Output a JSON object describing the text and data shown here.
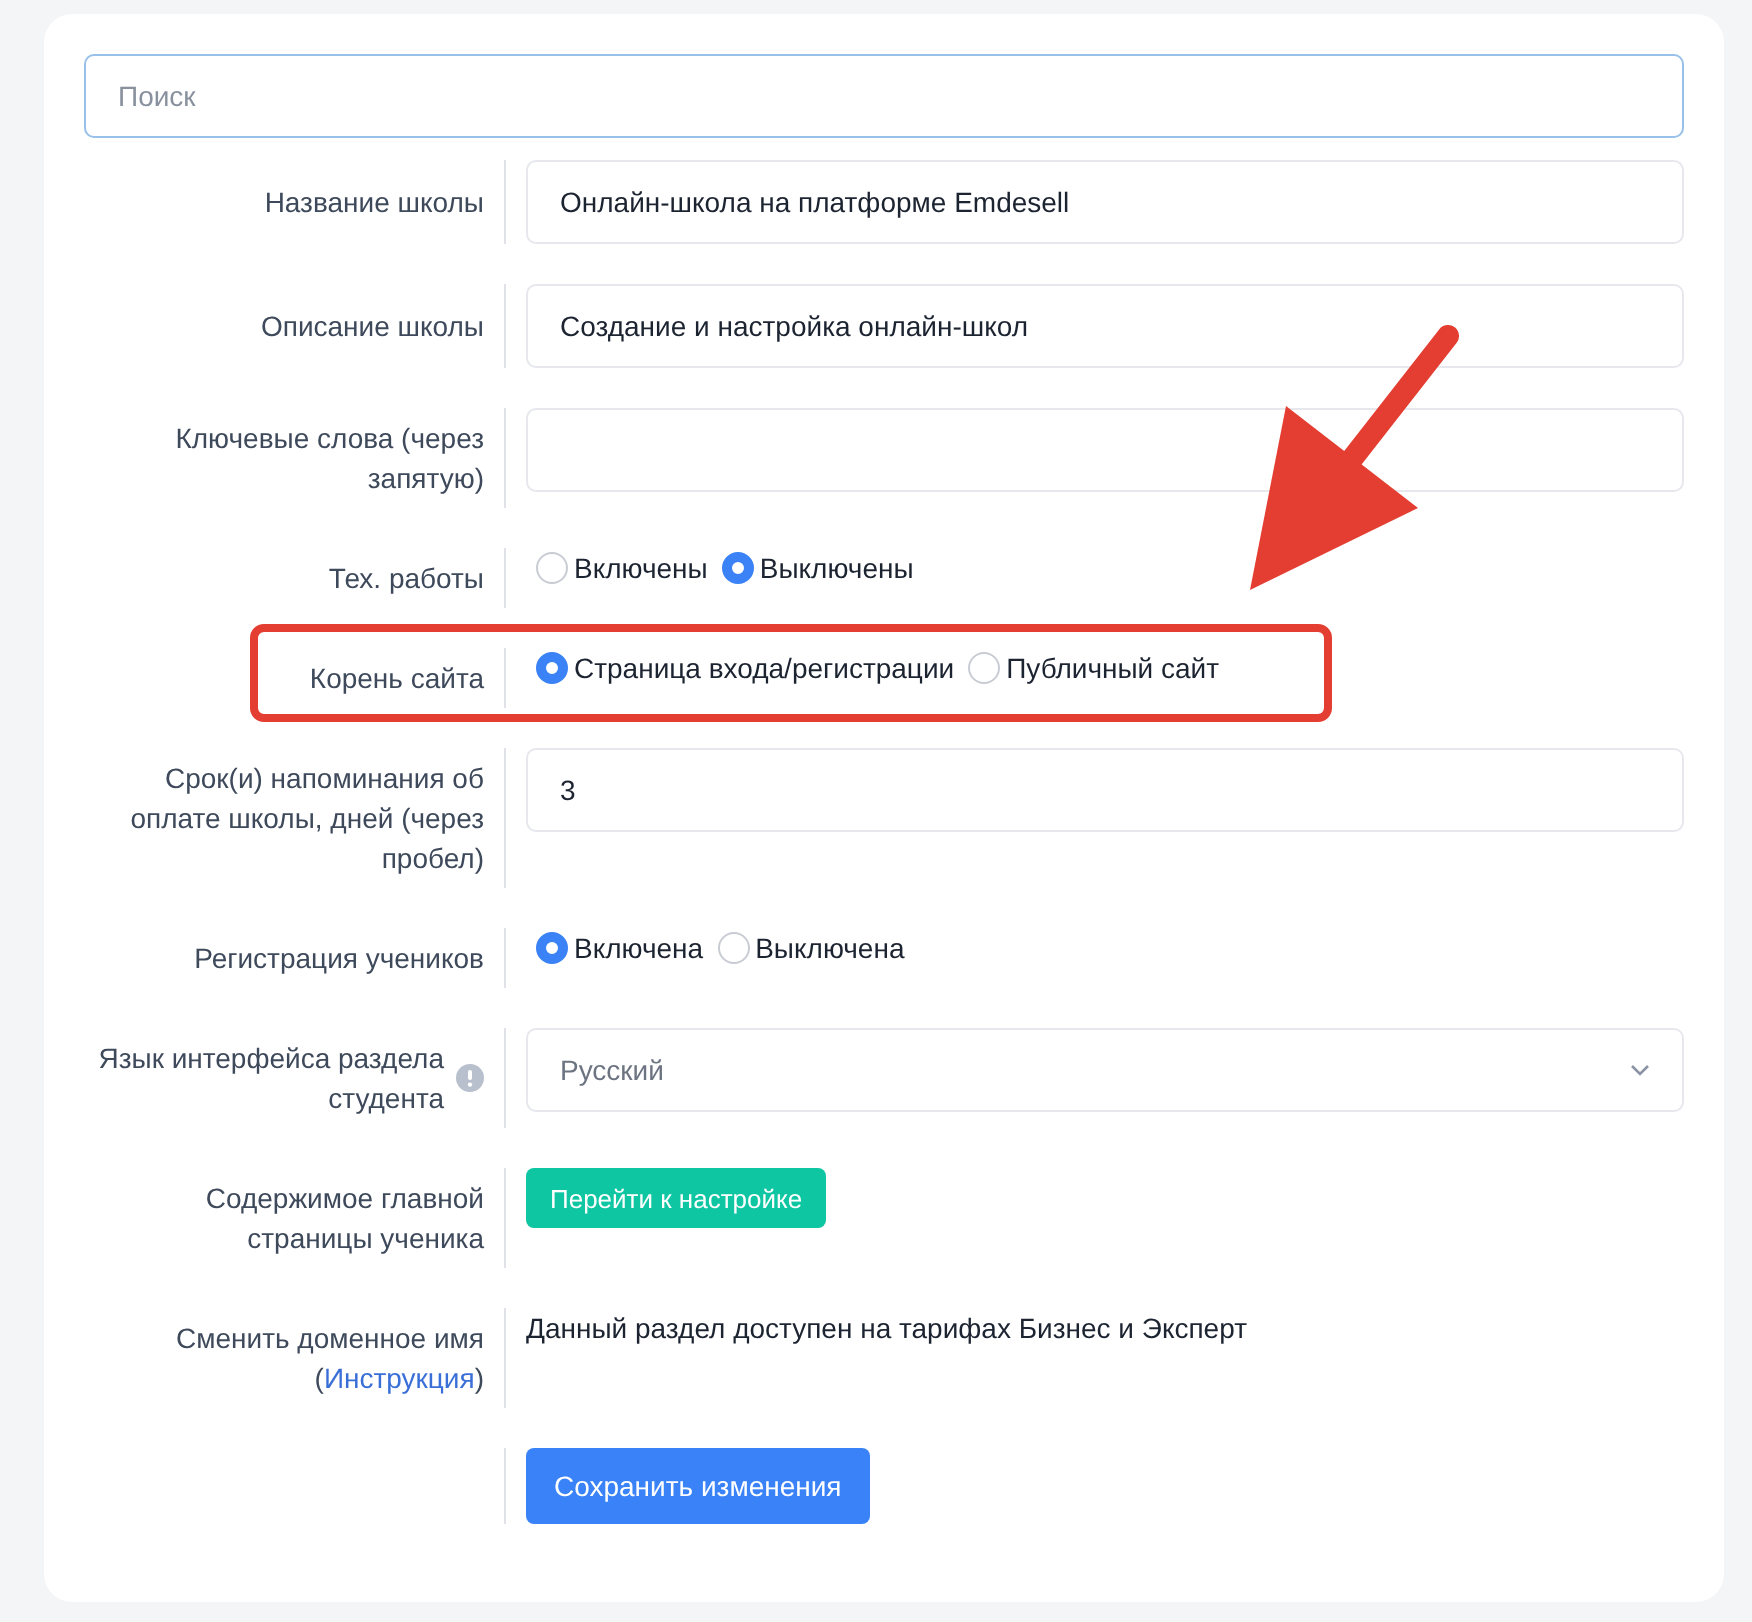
{
  "search": {
    "placeholder": "Поиск"
  },
  "rows": [
    {
      "kind": "text",
      "label": "Название школы",
      "info": false,
      "highlighted": false,
      "value": "Онлайн-школа на платформе Emdesell"
    },
    {
      "kind": "text",
      "label": "Описание школы",
      "info": false,
      "highlighted": false,
      "value": "Создание и настройка онлайн-школ"
    },
    {
      "kind": "text",
      "label": "Ключевые слова (через запятую)",
      "info": false,
      "highlighted": false
    },
    {
      "kind": "radio",
      "label": "Тех. работы",
      "info": false,
      "highlighted": false,
      "options": [
        {
          "label": "Включены",
          "selected": false
        },
        {
          "label": "Выключены",
          "selected": true
        }
      ]
    },
    {
      "kind": "radio",
      "label": "Корень сайта",
      "info": false,
      "highlighted": true,
      "options": [
        {
          "label": "Страница входа/регистрации",
          "selected": true
        },
        {
          "label": "Публичный сайт",
          "selected": false
        }
      ]
    },
    {
      "kind": "text",
      "label": "Срок(и) напоминания об оплате школы, дней (через пробел)",
      "info": false,
      "highlighted": false,
      "value": "3"
    },
    {
      "kind": "radio",
      "label": "Регистрация учеников",
      "info": false,
      "highlighted": false,
      "options": [
        {
          "label": "Включена",
          "selected": true
        },
        {
          "label": "Выключена",
          "selected": false
        }
      ]
    },
    {
      "kind": "select",
      "label": "Язык интерфейса раздела студента",
      "info": true,
      "highlighted": false,
      "value": "Русский"
    },
    {
      "kind": "button",
      "label": "Содержимое главной страницы ученика",
      "info": false,
      "highlighted": false,
      "button": "Перейти к настройке"
    },
    {
      "kind": "note",
      "label": "Сменить доменное имя",
      "link": {
        "before": "(",
        "text": "Инструкция",
        "after": ")"
      },
      "info": false,
      "highlighted": false,
      "text": "Данный раздел доступен на тарифах Бизнес и Эксперт"
    },
    {
      "kind": "submit",
      "info": false,
      "highlighted": false,
      "button": "Сохранить изменения"
    }
  ]
}
